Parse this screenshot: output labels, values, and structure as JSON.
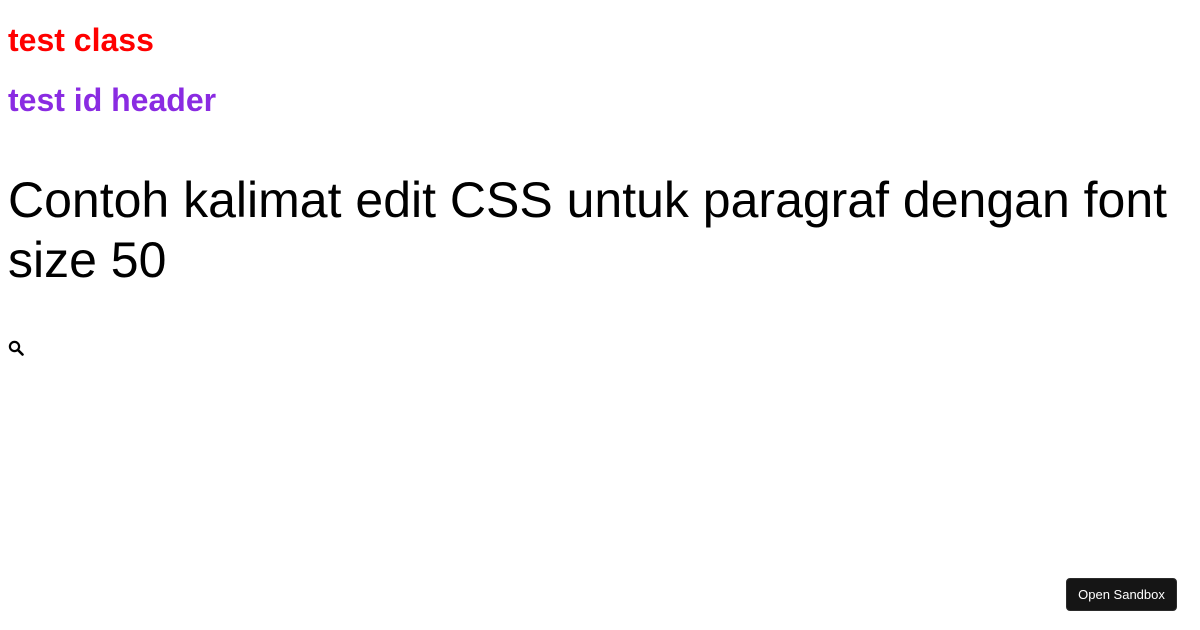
{
  "content": {
    "class_heading": "test class",
    "id_heading": "test id header",
    "paragraph": "Contoh kalimat edit CSS untuk paragraf dengan font size 50",
    "icon": "search-icon"
  },
  "sandbox": {
    "button_label": "Open Sandbox"
  },
  "colors": {
    "class_heading": "#ff0000",
    "id_heading": "#8a2be2",
    "button_bg": "#151515"
  }
}
